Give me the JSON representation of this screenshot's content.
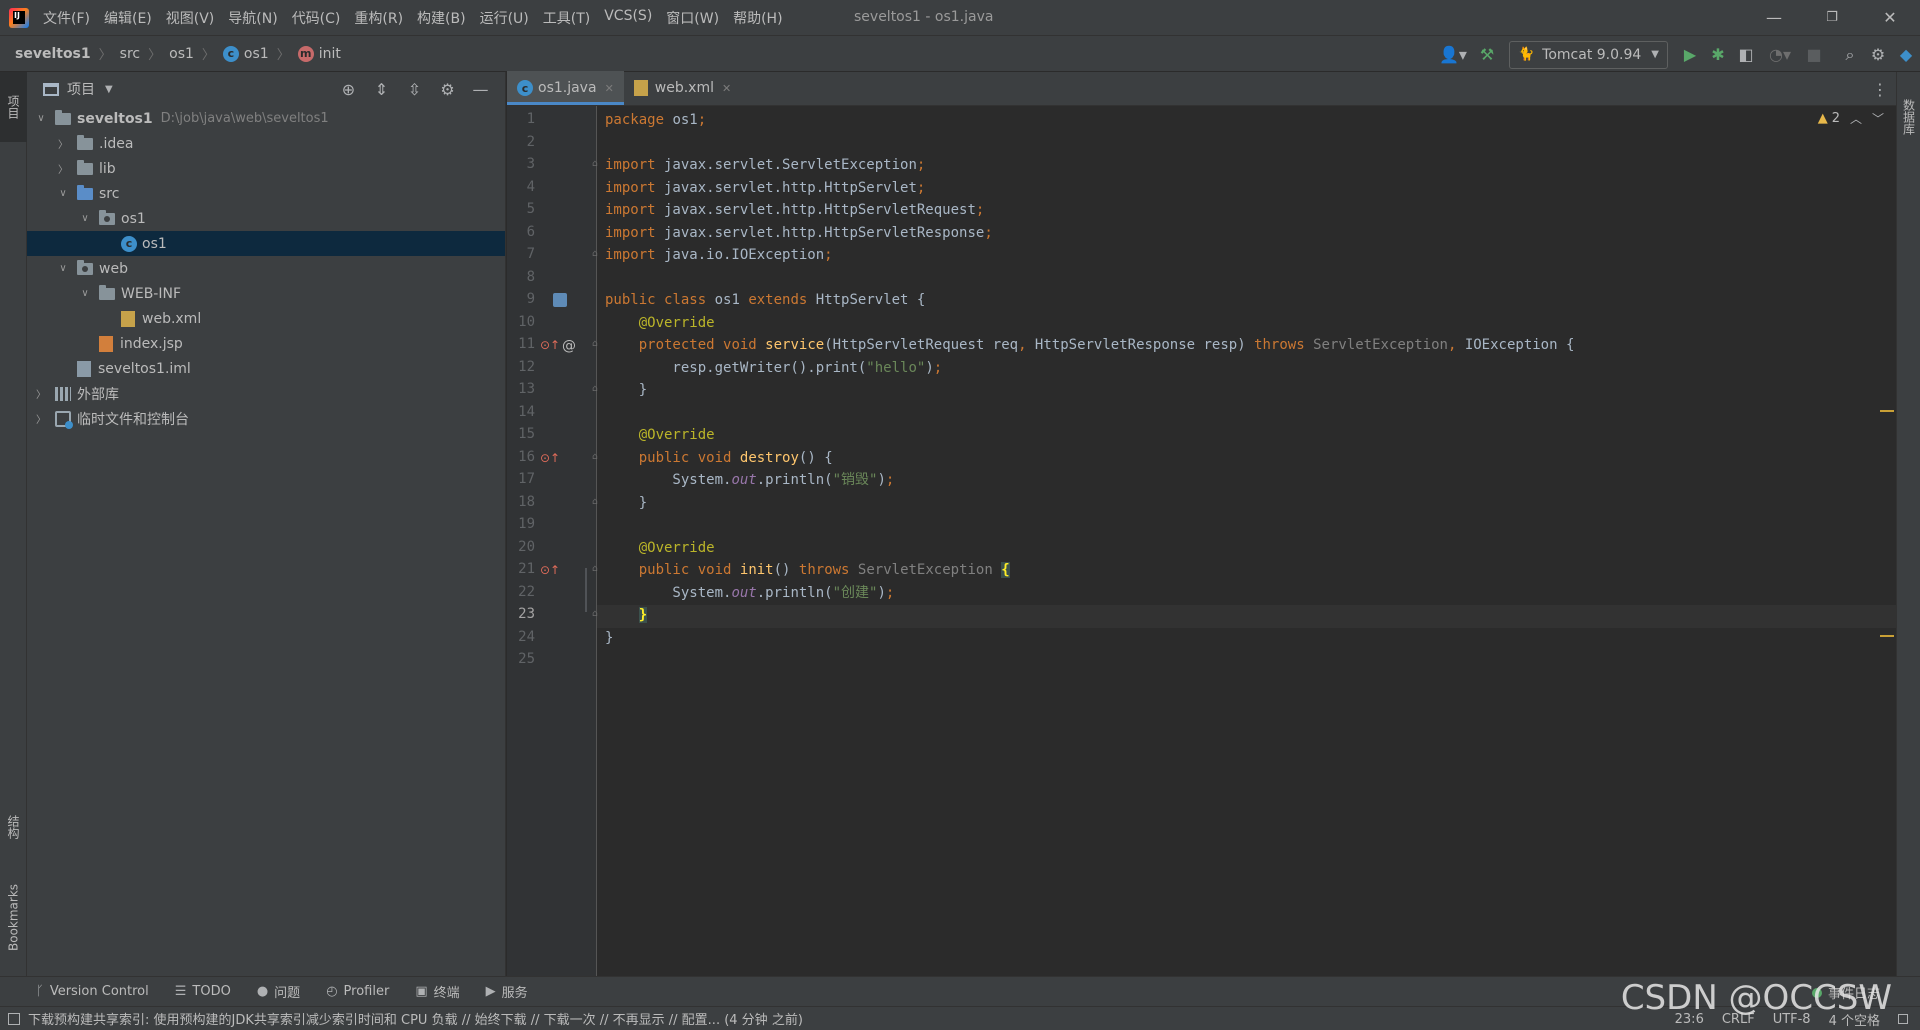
{
  "menu": [
    "文件(F)",
    "编辑(E)",
    "视图(V)",
    "导航(N)",
    "代码(C)",
    "重构(R)",
    "构建(B)",
    "运行(U)",
    "工具(T)",
    "VCS(S)",
    "窗口(W)",
    "帮助(H)"
  ],
  "window_title": "seveltos1 - os1.java",
  "window_controls": {
    "minimize": "—",
    "restore": "❐",
    "close": "✕"
  },
  "breadcrumb": {
    "project": "seveltos1",
    "src": "src",
    "pkg": "os1",
    "class": "os1",
    "class_badge": "c",
    "method": "init",
    "method_badge": "m"
  },
  "run_config": {
    "label": "Tomcat 9.0.94"
  },
  "project_panel": {
    "title": "项目"
  },
  "tree": {
    "root_name": "seveltos1",
    "root_path": "D:\\job\\java\\web\\seveltos1",
    "idea": ".idea",
    "lib": "lib",
    "src": "src",
    "os1_pkg": "os1",
    "os1_class": "os1",
    "web": "web",
    "webinf": "WEB-INF",
    "webxml": "web.xml",
    "indexjsp": "index.jsp",
    "iml": "seveltos1.iml",
    "ext_libs": "外部库",
    "scratches": "临时文件和控制台"
  },
  "tabs": [
    {
      "label": "os1.java",
      "active": true
    },
    {
      "label": "web.xml",
      "active": false
    }
  ],
  "inspections": {
    "warnings": "2"
  },
  "code_lines": [
    "package os1;",
    "",
    "import javax.servlet.ServletException;",
    "import javax.servlet.http.HttpServlet;",
    "import javax.servlet.http.HttpServletRequest;",
    "import javax.servlet.http.HttpServletResponse;",
    "import java.io.IOException;",
    "",
    "public class os1 extends HttpServlet {",
    "    @Override",
    "    protected void service(HttpServletRequest req, HttpServletResponse resp) throws ServletException, IOException {",
    "        resp.getWriter().print(\"hello\");",
    "    }",
    "",
    "    @Override",
    "    public void destroy() {",
    "        System.out.println(\"销毁\");",
    "    }",
    "",
    "    @Override",
    "    public void init() throws ServletException {",
    "        System.out.println(\"创建\");",
    "    }",
    "}",
    ""
  ],
  "current_line": 23,
  "left_stripe": {
    "project": "项目",
    "structure": "结构",
    "bookmarks": "Bookmarks"
  },
  "right_stripe": {
    "database": "数据库"
  },
  "bottom_tools": [
    "Version Control",
    "TODO",
    "问题",
    "Profiler",
    "终端",
    "服务"
  ],
  "event_log": "事件日志",
  "status": {
    "message": "下载预构建共享索引: 使用预构建的JDK共享索引减少索引时间和 CPU 负载 // 始终下载 // 下载一次 // 不再显示 // 配置... (4 分钟 之前)",
    "position": "23:6",
    "line_sep": "CRLF",
    "encoding": "UTF-8",
    "indent": "4 个空格"
  },
  "watermark": "CSDN @OCCSW",
  "colors": {
    "keyword": "#cc7832",
    "annotation": "#bbb529",
    "method": "#ffc66d",
    "string": "#6a8759",
    "accent": "#4a88c7"
  }
}
